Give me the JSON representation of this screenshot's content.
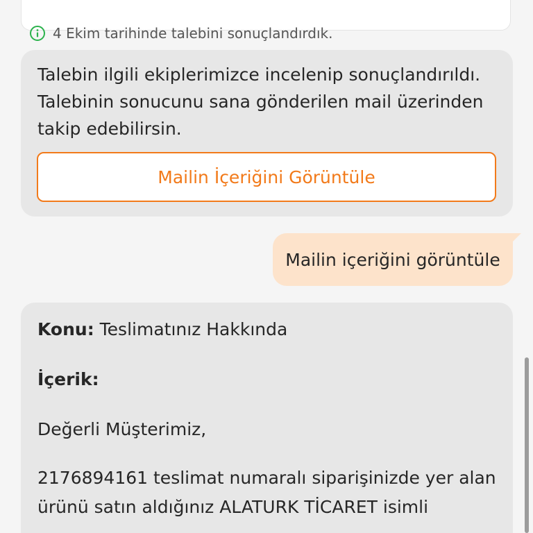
{
  "status_card": {
    "icon": "info-icon",
    "text": "4 Ekim tarihinde talebini sonuçlandırdık."
  },
  "bot_message": {
    "lines": [
      "Talebin ilgili ekiplerimizce incelenip sonuçlandırıldı.",
      "Talebinin sonucunu sana gönderilen mail üzerinden",
      "takip edebilirsin."
    ],
    "button_label": "Mailin İçeriğini Görüntüle"
  },
  "user_message": {
    "text": "Mailin içeriğini görüntüle"
  },
  "mail": {
    "subject_label": "Konu:",
    "subject_value": "Teslimatınız Hakkında",
    "content_label": "İçerik:",
    "greeting": "Değerli Müşterimiz,",
    "body_lines": [
      "2176894161 teslimat numaralı siparişinizde yer alan",
      "ürünü satın aldığınız ALATURK TİCARET isimli"
    ]
  },
  "colors": {
    "accent": "#f27a1a",
    "user_bubble": "#fde3cb",
    "bot_bubble": "#e7e7e7",
    "info_green": "#2bb24c"
  }
}
